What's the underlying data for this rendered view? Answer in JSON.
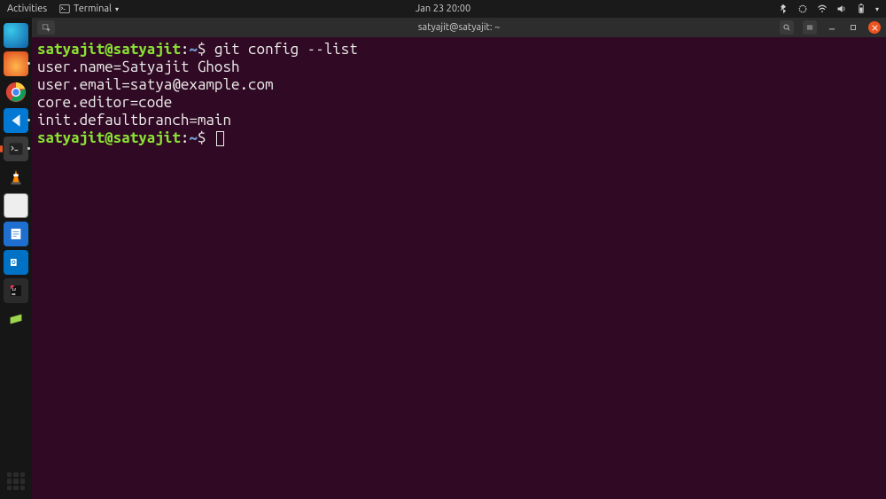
{
  "topbar": {
    "activities": "Activities",
    "app_name": "Terminal",
    "datetime": "Jan 23  20:00"
  },
  "window": {
    "title": "satyajit@satyajit: ~"
  },
  "terminal": {
    "prompt_user": "satyajit@satyajit",
    "prompt_colon": ":",
    "prompt_path": "~",
    "prompt_dollar": "$ ",
    "command": "git config --list",
    "output": [
      "user.name=Satyajit Ghosh",
      "user.email=satya@example.com",
      "core.editor=code",
      "init.defaultbranch=main"
    ]
  },
  "dock": {
    "items": [
      {
        "name": "edge-browser"
      },
      {
        "name": "firefox-browser"
      },
      {
        "name": "chrome-browser"
      },
      {
        "name": "vscode"
      },
      {
        "name": "terminal"
      },
      {
        "name": "vlc-player"
      },
      {
        "name": "files"
      },
      {
        "name": "libreoffice-writer"
      },
      {
        "name": "outlook"
      },
      {
        "name": "intellij"
      },
      {
        "name": "sublime-merge"
      }
    ]
  }
}
